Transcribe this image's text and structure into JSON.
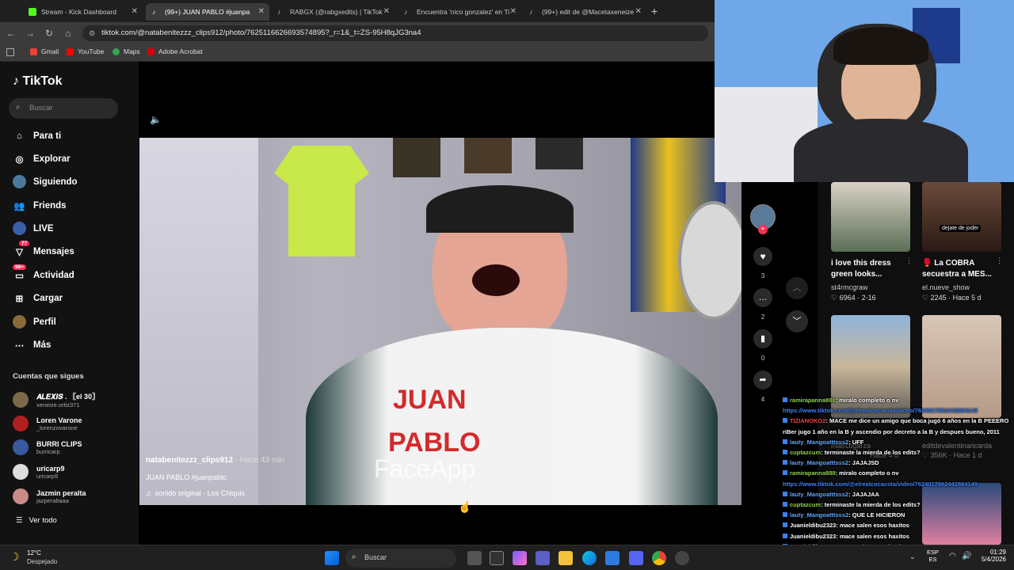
{
  "browser": {
    "tabs": [
      {
        "label": "Stream - Kick Dashboard",
        "active": false
      },
      {
        "label": "(99+) JUAN PABLO #juanpa",
        "active": true
      },
      {
        "label": "RABGX (@rabgxedits) | TikTok",
        "active": false
      },
      {
        "label": "Encuentra 'nico gonzalez' en Ti",
        "active": false
      },
      {
        "label": "(99+) edit de @Macetaxeneize",
        "active": false
      }
    ],
    "new_tab": "+",
    "url": "tiktok.com/@natabenitezzz_clips912/photo/7625116626693574895?_r=1&_t=ZS-95H8qJG3na4",
    "bookmarks": [
      "Gmail",
      "YouTube",
      "Maps",
      "Adobe Acrobat"
    ]
  },
  "tiktok": {
    "logo": "TikTok",
    "search_placeholder": "Buscar",
    "nav": [
      {
        "label": "Para ti",
        "icon": "home-icon"
      },
      {
        "label": "Explorar",
        "icon": "compass-icon"
      },
      {
        "label": "Siguiendo",
        "icon": "following-icon"
      },
      {
        "label": "Friends",
        "icon": "friends-icon"
      },
      {
        "label": "LIVE",
        "icon": "live-icon"
      },
      {
        "label": "Mensajes",
        "icon": "messages-icon",
        "badge": "77"
      },
      {
        "label": "Actividad",
        "icon": "activity-icon",
        "badge": "99+"
      },
      {
        "label": "Cargar",
        "icon": "upload-icon"
      },
      {
        "label": "Perfil",
        "icon": "profile-icon"
      },
      {
        "label": "Más",
        "icon": "more-icon"
      }
    ],
    "following_title": "Cuentas que sigues",
    "following": [
      {
        "name": "𝑨𝑳𝑬𝑿𝑰𝑺 . 〖el 30〗",
        "handle": "xeneize.ortiz371"
      },
      {
        "name": "Loren Varone",
        "handle": "_lorenzovarone"
      },
      {
        "name": "BURRI CLIPS",
        "handle": "burricarp"
      },
      {
        "name": "uricarp9",
        "handle": "uricarp9"
      },
      {
        "name": "Jazmin peralta",
        "handle": "jazperaltaaa"
      }
    ],
    "see_all": "Ver todo",
    "post": {
      "author": "natabenitezzz_clips912",
      "time": "Hace 43 min",
      "caption": "JUAN PABLO #juanpablo",
      "sound": "sonido original - Los Chiquis",
      "shirt_text_1": "JUAN",
      "shirt_text_2": "PABLO",
      "watermark": "FaceApp"
    },
    "actions": {
      "likes": "3",
      "comments": "2",
      "saves": "0",
      "shares": "4"
    },
    "suggested": [
      {
        "title": "i love this dress green looks...",
        "user": "st4rmcgraw",
        "likes": "6964",
        "date": "2-16"
      },
      {
        "title": "🥊 La COBRA secuestra a MES...",
        "user": "el.nueve_show",
        "likes": "2245",
        "date": "Hace 5 d",
        "overlay": "dejate de joder"
      },
      {
        "title": "",
        "user": "matrcbgarza",
        "likes": "",
        "date": "Hace 4 d"
      },
      {
        "title": "",
        "user": "editdevalentinaricarda",
        "likes": "356K",
        "date": "Hace 1 d"
      }
    ]
  },
  "chat": [
    {
      "user": "ramirapanna888",
      "msg": ": miralo completo o nv",
      "color": "#8fd14f"
    },
    {
      "user": "",
      "msg": "https://www.tiktok.com/@elrealcocacola/video/7624017962442884149",
      "color": "#3b82f6"
    },
    {
      "user": "TIZIANOKO2",
      "msg": ": MACE me dice un amigo que boca jugó 6 años en la B PEEERO",
      "color": "#ef4444"
    },
    {
      "user": "",
      "msg": "riBer jugo 1 año en la B y ascendio por decreto a la B y despues bueno, 2011",
      "color": "#ffffff"
    },
    {
      "user": "lauty_Mangoatttsss2",
      "msg": ": UFF",
      "color": "#60a5fa"
    },
    {
      "user": "cuptazcum",
      "msg": ": terminaste la mierda de los edits?",
      "color": "#8fd14f"
    },
    {
      "user": "lauty_Mangoatttsss2",
      "msg": ": JAJAJSD",
      "color": "#60a5fa"
    },
    {
      "user": "ramirapanna888",
      "msg": ": miralo completo o nv",
      "color": "#8fd14f"
    },
    {
      "user": "",
      "msg": "https://www.tiktok.com/@elrealcocacola/video/7624017962442884149",
      "color": "#3b82f6"
    },
    {
      "user": "lauty_Mangoatttsss2",
      "msg": ": JAJAJAA",
      "color": "#60a5fa"
    },
    {
      "user": "cuptazcum",
      "msg": ": terminaste la mierda de los edits?",
      "color": "#8fd14f"
    },
    {
      "user": "lauty_Mangoatttsss2",
      "msg": ": QUE LE HICIERON",
      "color": "#60a5fa"
    },
    {
      "user": "Juanieldibu2323",
      "msg": ": mace salen esos haxitos",
      "color": "#ffffff"
    },
    {
      "user": "Juanieldibu2323",
      "msg": ": mace salen esos haxitos",
      "color": "#ffffff"
    },
    {
      "user": "Juanieldibu2323",
      "msg": ": mace salen esos haxitos",
      "color": "#ffffff"
    },
    {
      "user": "Juanieldibu2323",
      "msg": ": mace salen esos haxitos",
      "color": "#ffffff"
    }
  ],
  "taskbar": {
    "weather_temp": "12°C",
    "weather_desc": "Despejado",
    "search": "Buscar",
    "lang_1": "ESP",
    "lang_2": "ES",
    "time": "01:29",
    "date": "5/4/2026"
  }
}
